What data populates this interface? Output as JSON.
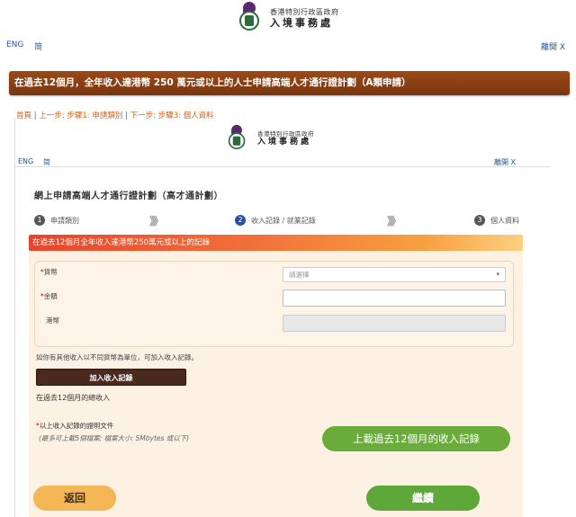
{
  "header": {
    "dept_line1": "香港特別行政區政府",
    "dept_line2": "入境事務處",
    "lang_en": "ENG",
    "lang_sc": "简",
    "exit": "離開 X"
  },
  "title_bar": "在過去12個月，全年收入達港幣 250 萬元或以上的人士申請高端人才通行證計劃（A類申請）",
  "breadcrumb": {
    "home": "首頁",
    "prev": "上一步: 步驟1: 申請類別",
    "next": "下一步: 步驟3: 個人資料",
    "sep": "|"
  },
  "inner_header": {
    "dept_line1": "香港特別行政區政府",
    "dept_line2": "入境事務處",
    "lang_en": "ENG",
    "lang_sc": "简",
    "exit": "離開 X"
  },
  "form_title": "網上申請高端人才通行證計劃（高才通計劃）",
  "steps": [
    {
      "num": "1",
      "label": "申請類別"
    },
    {
      "num": "2",
      "label": "收入記錄 / 就業記錄"
    },
    {
      "num": "3",
      "label": "個人資料"
    }
  ],
  "step_chevrons": "》》》",
  "section_title": "在過去12個月全年收入達港幣250萬元或以上的記錄",
  "fields": {
    "currency_label": "貨幣",
    "currency_placeholder": "請選擇",
    "amount_label": "金額",
    "hkd_label": "港幣",
    "required_mark": "*"
  },
  "hint": "如你有其他收入以不同貨幣為單位，可加入收入記錄。",
  "add_button": "加入收入記錄",
  "total_label": "在過去12個月的總收入",
  "doc_label": "以上收入記錄的證明文件",
  "doc_note": "(最多可上載5個檔案; 檔案大小: 5Mbytes 或以下)",
  "upload_button": "上載過去12個月的收入記錄",
  "back_button": "返回",
  "next_button": "繼續"
}
